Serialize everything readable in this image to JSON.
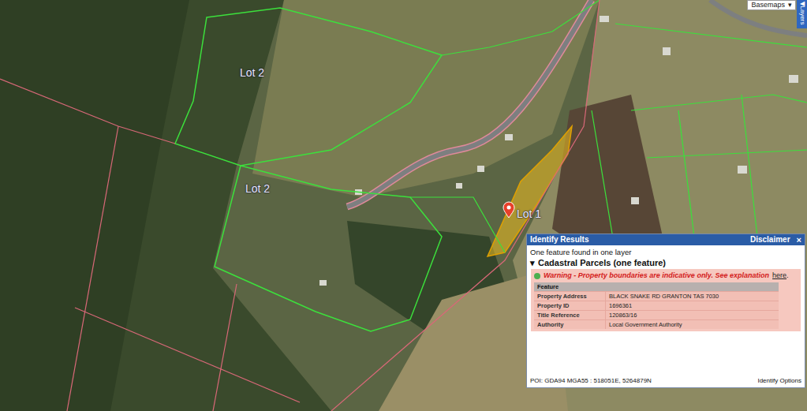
{
  "map": {
    "basemaps_button": {
      "label": "Basemaps",
      "arrow": "▾"
    },
    "layers_tab": {
      "label": "Layers",
      "arrow": "◀"
    },
    "parcel_labels": [
      {
        "label": "Lot 2",
        "selected": false
      },
      {
        "label": "Lot 2",
        "selected": false
      },
      {
        "label": "Lot 1",
        "selected": true
      }
    ],
    "marker": {
      "shown": true
    }
  },
  "identify_panel": {
    "title": "Identify Results",
    "disclaimer": "Disclaimer",
    "close": "×",
    "summary": "One feature found in one layer",
    "section": {
      "toggle": "▾",
      "title": "Cadastral Parcels (one feature)",
      "expanded": true
    },
    "warning": {
      "text": "Warning - Property boundaries are indicative only. See explanation",
      "link": "here",
      "suffix": "."
    },
    "table": {
      "header": "Feature",
      "rows": [
        {
          "label": "Property Address",
          "value": "BLACK SNAKE RD GRANTON TAS 7030"
        },
        {
          "label": "Property ID",
          "value": "1696361"
        },
        {
          "label": "Title Reference",
          "value": "120863/16"
        },
        {
          "label": "Authority",
          "value": "Local Government Authority"
        }
      ]
    },
    "footer": {
      "poi": "POI: GDA94 MGA55 : 518051E, 5264879N",
      "options": "Identify Options"
    }
  }
}
